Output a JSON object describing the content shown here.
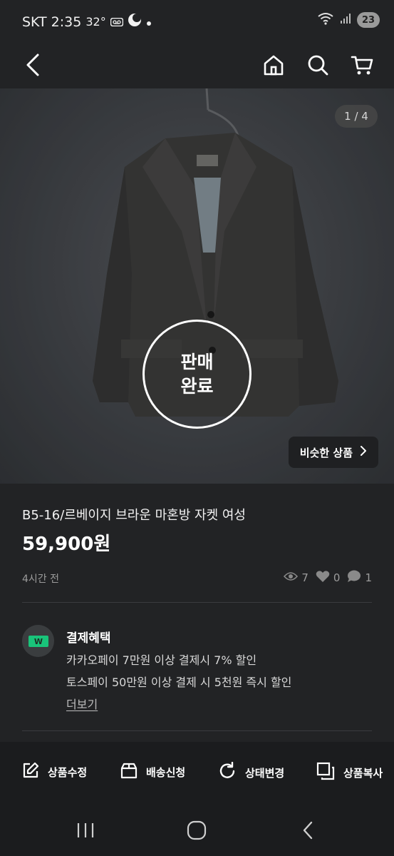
{
  "status_bar": {
    "carrier": "SKT",
    "time": "2:35",
    "temperature": "32°",
    "battery": "23",
    "icons": [
      "voicemail-icon",
      "moon-icon",
      "dot-icon",
      "wifi-icon",
      "signal-icon"
    ]
  },
  "top_nav": {
    "icons": [
      "back-arrow-icon",
      "home-icon",
      "search-icon",
      "cart-icon"
    ]
  },
  "gallery": {
    "page_indicator": "1 / 4",
    "sold_line1": "판매",
    "sold_line2": "완료",
    "similar_label": "비슷한 상품"
  },
  "product": {
    "title": "B5-16/르베이지 브라운 마혼방 자켓 여성",
    "price": "59,900원",
    "posted": "4시간 전",
    "views": "7",
    "likes": "0",
    "chats": "1"
  },
  "benefits": {
    "title": "결제혜택",
    "lines": [
      "카카오페이 7만원 이상 결제시 7% 할인",
      "토스페이 50만원 이상 결제 시 5천원 즉시 할인"
    ],
    "more": "더보기"
  },
  "actions": [
    {
      "label": "상품수정",
      "icon": "edit-icon"
    },
    {
      "label": "배송신청",
      "icon": "box-icon"
    },
    {
      "label": "상태변경",
      "icon": "refresh-icon"
    },
    {
      "label": "상품복사",
      "icon": "copy-icon"
    }
  ],
  "colors": {
    "background": "#222325",
    "bar": "#1b1c1e",
    "accent_green": "#19c47a"
  }
}
